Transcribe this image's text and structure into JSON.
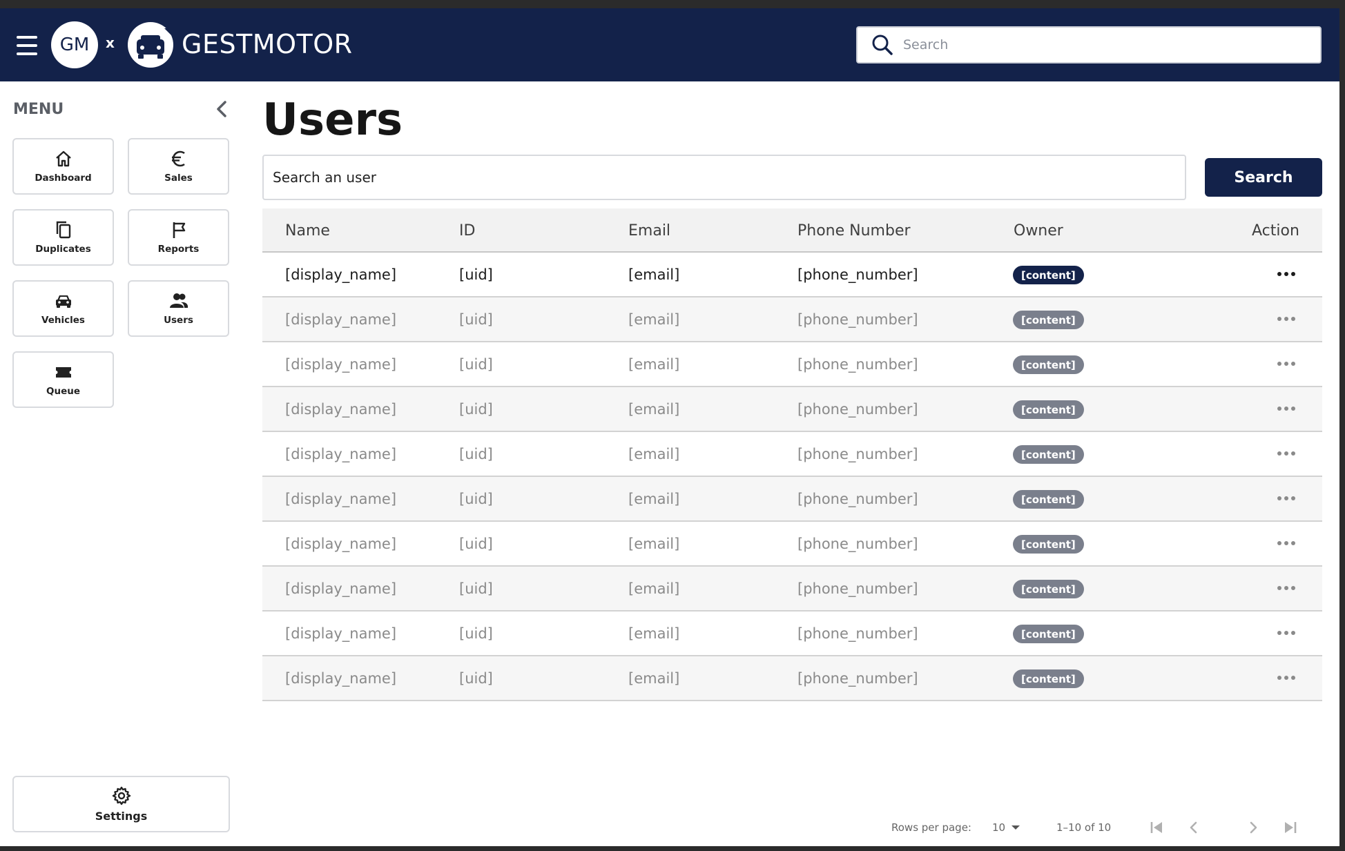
{
  "header": {
    "gm_logo_text": "GM",
    "separator": "x",
    "brand_name": "GESTMOTOR",
    "search_placeholder": "Search"
  },
  "sidebar": {
    "menu_title": "MENU",
    "items": [
      {
        "label": "Dashboard",
        "icon": "home-icon"
      },
      {
        "label": "Sales",
        "icon": "euro-icon"
      },
      {
        "label": "Duplicates",
        "icon": "copy-icon"
      },
      {
        "label": "Reports",
        "icon": "flag-icon"
      },
      {
        "label": "Vehicles",
        "icon": "car-icon"
      },
      {
        "label": "Users",
        "icon": "users-icon"
      },
      {
        "label": "Queue",
        "icon": "ticket-icon"
      }
    ],
    "settings_label": "Settings"
  },
  "main": {
    "title": "Users",
    "search_value": "Search an user",
    "search_button": "Search",
    "table": {
      "columns": [
        "Name",
        "ID",
        "Email",
        "Phone Number",
        "Owner",
        "Action"
      ],
      "rows": [
        {
          "name": "[display_name]",
          "id": "[uid]",
          "email": "[email]",
          "phone": "[phone_number]",
          "owner": "[content]"
        },
        {
          "name": "[display_name]",
          "id": "[uid]",
          "email": "[email]",
          "phone": "[phone_number]",
          "owner": "[content]"
        },
        {
          "name": "[display_name]",
          "id": "[uid]",
          "email": "[email]",
          "phone": "[phone_number]",
          "owner": "[content]"
        },
        {
          "name": "[display_name]",
          "id": "[uid]",
          "email": "[email]",
          "phone": "[phone_number]",
          "owner": "[content]"
        },
        {
          "name": "[display_name]",
          "id": "[uid]",
          "email": "[email]",
          "phone": "[phone_number]",
          "owner": "[content]"
        },
        {
          "name": "[display_name]",
          "id": "[uid]",
          "email": "[email]",
          "phone": "[phone_number]",
          "owner": "[content]"
        },
        {
          "name": "[display_name]",
          "id": "[uid]",
          "email": "[email]",
          "phone": "[phone_number]",
          "owner": "[content]"
        },
        {
          "name": "[display_name]",
          "id": "[uid]",
          "email": "[email]",
          "phone": "[phone_number]",
          "owner": "[content]"
        },
        {
          "name": "[display_name]",
          "id": "[uid]",
          "email": "[email]",
          "phone": "[phone_number]",
          "owner": "[content]"
        },
        {
          "name": "[display_name]",
          "id": "[uid]",
          "email": "[email]",
          "phone": "[phone_number]",
          "owner": "[content]"
        }
      ]
    },
    "pagination": {
      "rows_per_page_label": "Rows per page:",
      "rows_per_page_value": "10",
      "range": "1–10 of 10"
    }
  },
  "colors": {
    "header_bg": "#13224a",
    "primary_button": "#13224a",
    "badge_active": "#13224a",
    "badge_muted": "#7a7f8c"
  }
}
